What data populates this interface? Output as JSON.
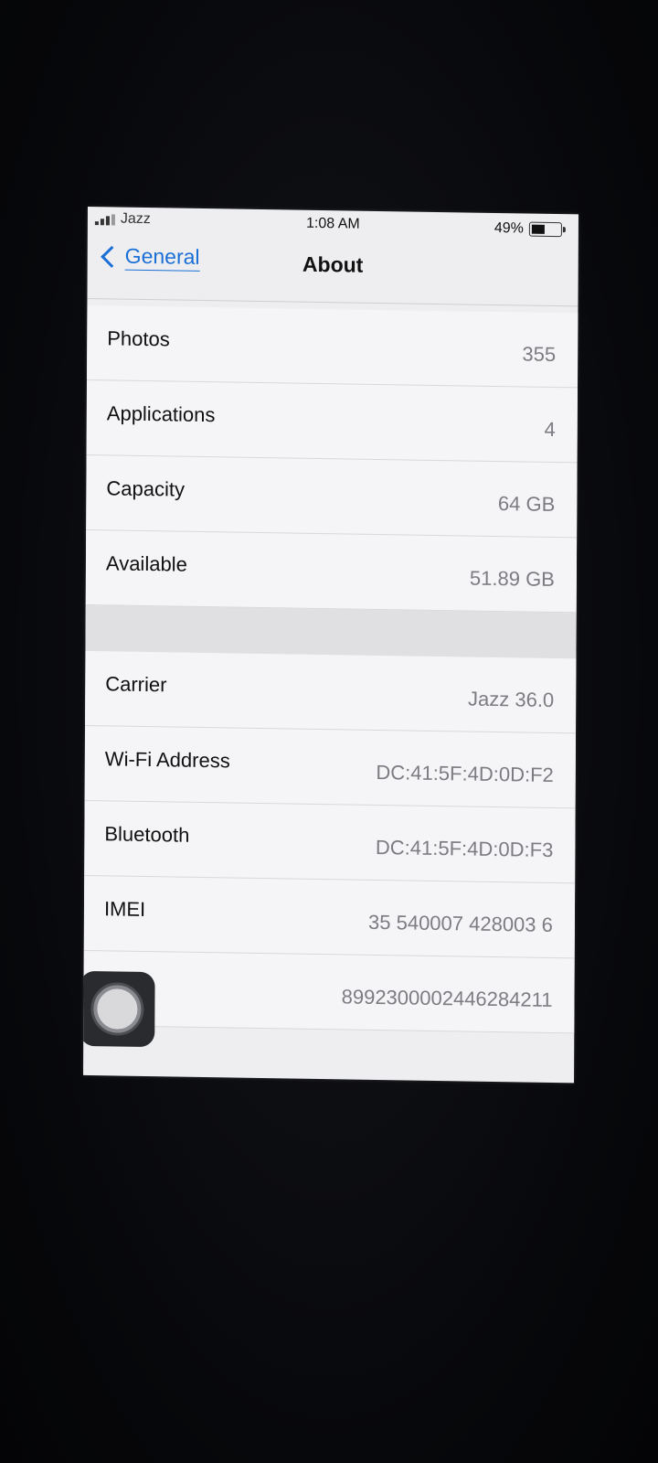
{
  "status_bar": {
    "carrier": "Jazz",
    "time": "1:08 AM",
    "battery_percent": "49%",
    "battery_level": 0.49
  },
  "nav": {
    "back_label": "General",
    "title": "About"
  },
  "group1": [
    {
      "label": "Photos",
      "value": "355"
    },
    {
      "label": "Applications",
      "value": "4"
    },
    {
      "label": "Capacity",
      "value": "64 GB"
    },
    {
      "label": "Available",
      "value": "51.89 GB"
    }
  ],
  "group2": [
    {
      "label": "Carrier",
      "value": "Jazz 36.0"
    },
    {
      "label": "Wi-Fi Address",
      "value": "DC:41:5F:4D:0D:F2"
    },
    {
      "label": "Bluetooth",
      "value": "DC:41:5F:4D:0D:F3"
    },
    {
      "label": "IMEI",
      "value": "35 540007 428003 6"
    },
    {
      "label": "",
      "value": "89923000024462842​11"
    }
  ],
  "icons": {
    "back": "chevron-left-icon",
    "assistive_touch": "assistive-touch-icon",
    "battery": "battery-icon",
    "signal": "signal-icon"
  },
  "colors": {
    "accent": "#1a6fd6",
    "background": "#eeeef0",
    "value_text": "#7c7c82"
  }
}
